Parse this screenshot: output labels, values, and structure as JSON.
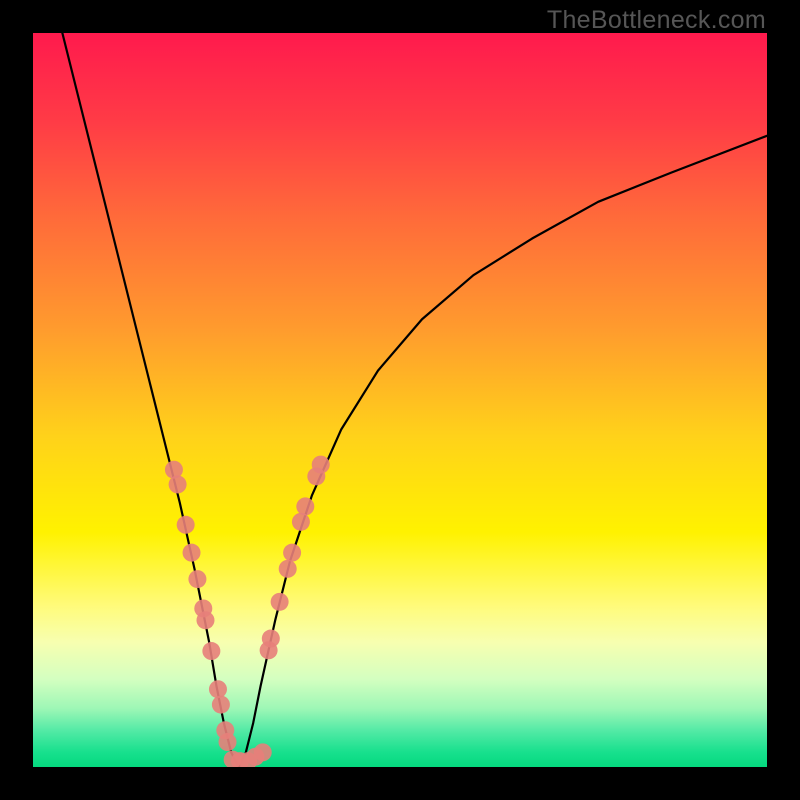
{
  "watermark": "TheBottleneck.com",
  "chart_data": {
    "type": "line",
    "title": "",
    "xlabel": "",
    "ylabel": "",
    "xlim": [
      0,
      100
    ],
    "ylim": [
      0,
      100
    ],
    "grid": false,
    "legend": false,
    "gradient_stops": [
      {
        "offset": 0.0,
        "color": "#ff1a4d"
      },
      {
        "offset": 0.12,
        "color": "#ff3b46"
      },
      {
        "offset": 0.25,
        "color": "#ff6a3a"
      },
      {
        "offset": 0.4,
        "color": "#ff9a2e"
      },
      {
        "offset": 0.55,
        "color": "#ffd21a"
      },
      {
        "offset": 0.68,
        "color": "#fff200"
      },
      {
        "offset": 0.78,
        "color": "#fffb7a"
      },
      {
        "offset": 0.83,
        "color": "#f7ffb0"
      },
      {
        "offset": 0.88,
        "color": "#d4ffc0"
      },
      {
        "offset": 0.92,
        "color": "#9ef7b6"
      },
      {
        "offset": 0.95,
        "color": "#54eaa6"
      },
      {
        "offset": 0.98,
        "color": "#17e08d"
      },
      {
        "offset": 1.0,
        "color": "#05d97f"
      }
    ],
    "series": [
      {
        "name": "bottleneck-curve-left",
        "x": [
          4,
          6,
          8,
          10,
          12,
          14,
          16,
          18,
          20,
          22,
          24,
          25,
          26,
          27,
          28
        ],
        "y": [
          100,
          92,
          84,
          76,
          68,
          60,
          52,
          44,
          36,
          27,
          17,
          11,
          6,
          2,
          0
        ]
      },
      {
        "name": "bottleneck-curve-right",
        "x": [
          28,
          29,
          30,
          31,
          33,
          35,
          38,
          42,
          47,
          53,
          60,
          68,
          77,
          87,
          100
        ],
        "y": [
          0,
          2,
          6,
          11,
          20,
          28,
          37,
          46,
          54,
          61,
          67,
          72,
          77,
          81,
          86
        ]
      }
    ],
    "markers": {
      "left": [
        {
          "x": 19.2,
          "y": 40.5
        },
        {
          "x": 19.7,
          "y": 38.5
        },
        {
          "x": 20.8,
          "y": 33.0
        },
        {
          "x": 21.6,
          "y": 29.2
        },
        {
          "x": 22.4,
          "y": 25.6
        },
        {
          "x": 23.2,
          "y": 21.6
        },
        {
          "x": 23.5,
          "y": 20.0
        },
        {
          "x": 24.3,
          "y": 15.8
        },
        {
          "x": 25.2,
          "y": 10.6
        },
        {
          "x": 25.6,
          "y": 8.5
        },
        {
          "x": 26.2,
          "y": 5.0
        },
        {
          "x": 26.5,
          "y": 3.4
        }
      ],
      "bottom": [
        {
          "x": 27.2,
          "y": 1.0
        },
        {
          "x": 28.2,
          "y": 0.8
        },
        {
          "x": 29.3,
          "y": 0.8
        },
        {
          "x": 30.3,
          "y": 1.4
        },
        {
          "x": 31.3,
          "y": 2.0
        }
      ],
      "right": [
        {
          "x": 32.1,
          "y": 15.9
        },
        {
          "x": 32.4,
          "y": 17.5
        },
        {
          "x": 33.6,
          "y": 22.5
        },
        {
          "x": 34.7,
          "y": 27.0
        },
        {
          "x": 35.3,
          "y": 29.2
        },
        {
          "x": 36.5,
          "y": 33.4
        },
        {
          "x": 37.1,
          "y": 35.5
        },
        {
          "x": 38.6,
          "y": 39.6
        },
        {
          "x": 39.2,
          "y": 41.2
        }
      ]
    },
    "marker_style": {
      "radius": 9,
      "fill": "#e77f7a",
      "fill_opacity": 0.9
    }
  }
}
